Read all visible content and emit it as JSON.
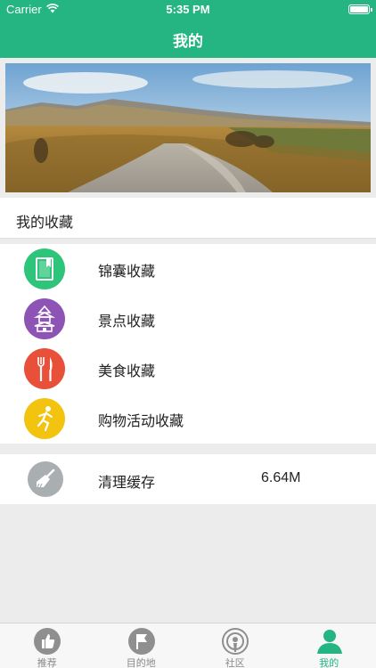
{
  "status_bar": {
    "carrier": "Carrier",
    "time": "5:35 PM"
  },
  "nav": {
    "title": "我的"
  },
  "section": {
    "title": "我的收藏"
  },
  "favorites": [
    {
      "label": "锦囊收藏",
      "icon": "book-icon",
      "color": "#2ec47a"
    },
    {
      "label": "景点收藏",
      "icon": "pagoda-icon",
      "color": "#8e54b5"
    },
    {
      "label": "美食收藏",
      "icon": "fork-knife-icon",
      "color": "#e8503a"
    },
    {
      "label": "购物活动收藏",
      "icon": "running-man-icon",
      "color": "#f2c40f"
    }
  ],
  "cache": {
    "label": "清理缓存",
    "value": "6.64M",
    "icon": "broom-icon"
  },
  "tabs": [
    {
      "label": "推荐",
      "icon": "thumbs-up-icon",
      "active": false
    },
    {
      "label": "目的地",
      "icon": "flag-icon",
      "active": false
    },
    {
      "label": "社区",
      "icon": "podcast-icon",
      "active": false
    },
    {
      "label": "我的",
      "icon": "user-icon",
      "active": true
    }
  ],
  "colors": {
    "brand": "#24b583",
    "tab_inactive": "#8a8a8a",
    "background": "#ececec"
  }
}
